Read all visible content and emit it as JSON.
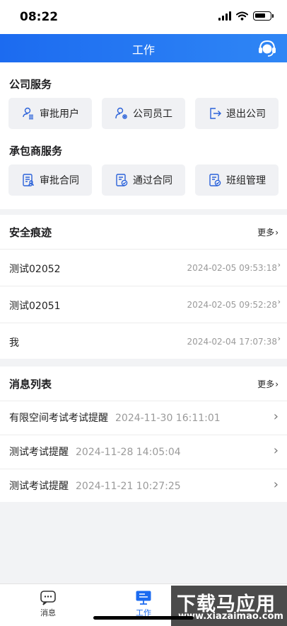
{
  "status_bar": {
    "time": "08:22"
  },
  "header": {
    "title": "工作"
  },
  "company_services": {
    "title": "公司服务",
    "items": [
      {
        "label": "审批用户",
        "icon": "user-list-icon"
      },
      {
        "label": "公司员工",
        "icon": "user-settings-icon"
      },
      {
        "label": "退出公司",
        "icon": "logout-icon"
      }
    ]
  },
  "contractor_services": {
    "title": "承包商服务",
    "items": [
      {
        "label": "审批合同",
        "icon": "contract-user-icon"
      },
      {
        "label": "通过合同",
        "icon": "contract-check-icon"
      },
      {
        "label": "班组管理",
        "icon": "team-check-icon"
      }
    ]
  },
  "security_trace": {
    "title": "安全痕迹",
    "more_label": "更多",
    "rows": [
      {
        "name": "测试02052",
        "time": "2024-02-05 09:53:18"
      },
      {
        "name": "测试02051",
        "time": "2024-02-05 09:52:28"
      },
      {
        "name": "我",
        "time": "2024-02-04 17:07:38"
      }
    ]
  },
  "messages": {
    "title": "消息列表",
    "more_label": "更多",
    "rows": [
      {
        "name": "有限空间考试考试提醒",
        "time": "2024-11-30 16:11:01"
      },
      {
        "name": "测试考试提醒",
        "time": "2024-11-28 14:05:04"
      },
      {
        "name": "测试考试提醒",
        "time": "2024-11-21 10:27:25"
      }
    ]
  },
  "tabbar": {
    "tabs": [
      {
        "label": "消息",
        "icon": "chat-icon",
        "active": false
      },
      {
        "label": "工作",
        "icon": "desktop-icon",
        "active": true
      }
    ]
  },
  "watermark": {
    "title": "下载马应用",
    "url": "www.xiazaimao.com"
  },
  "colors": {
    "accent": "#1c6bf0",
    "icon_blue": "#2b62d9",
    "muted": "#9a9a9a"
  }
}
